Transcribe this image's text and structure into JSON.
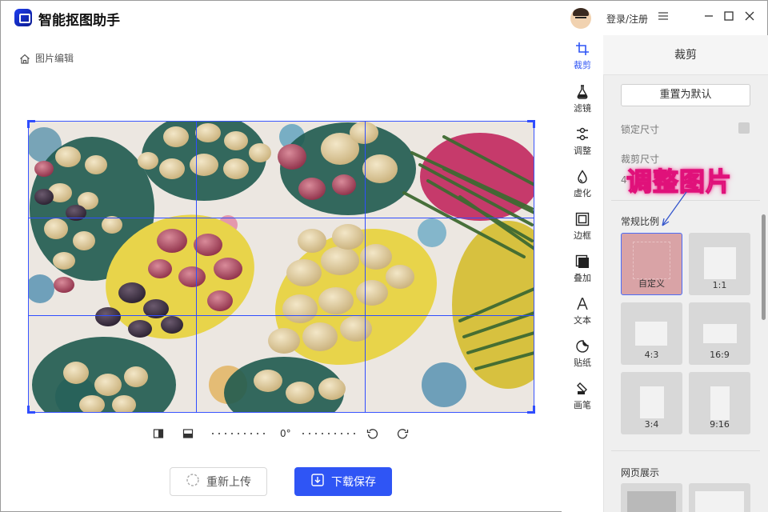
{
  "app": {
    "title": "智能抠图助手"
  },
  "header": {
    "login_label": "登录/注册",
    "menu_icon": "hamburger-icon",
    "minimize": "—",
    "maximize": "☐",
    "close": "✕"
  },
  "breadcrumb": {
    "label": "图片编辑"
  },
  "editor": {
    "rotation_label": "0°"
  },
  "actions": {
    "reupload_label": "重新上传",
    "save_label": "下载保存"
  },
  "tools": [
    {
      "label": "裁剪",
      "icon": "crop-icon",
      "active": true
    },
    {
      "label": "滤镜",
      "icon": "flask-icon"
    },
    {
      "label": "调整",
      "icon": "sliders-icon"
    },
    {
      "label": "虚化",
      "icon": "drop-icon"
    },
    {
      "label": "边框",
      "icon": "frame-icon"
    },
    {
      "label": "叠加",
      "icon": "overlay-icon"
    },
    {
      "label": "文本",
      "icon": "text-icon"
    },
    {
      "label": "贴纸",
      "icon": "sticker-icon"
    },
    {
      "label": "画笔",
      "icon": "brush-icon"
    }
  ],
  "panel": {
    "title": "裁剪",
    "reset_label": "重置为默认",
    "lock_label": "锁定尺寸",
    "size_label": "裁剪尺寸",
    "size_prefix": "4",
    "ratio_section": "常规比例",
    "ratios": [
      {
        "label": "自定义",
        "selected": true
      },
      {
        "label": "1:1"
      },
      {
        "label": "4:3"
      },
      {
        "label": "16:9"
      },
      {
        "label": "3:4"
      },
      {
        "label": "9:16"
      }
    ],
    "web_section": "网页展示"
  },
  "annotation": {
    "text": "调整图片",
    "color": "#e0117a"
  }
}
